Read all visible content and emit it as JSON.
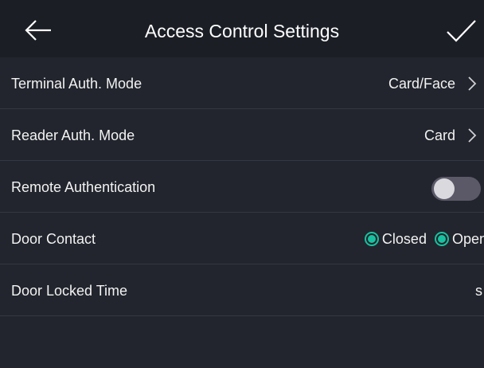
{
  "header": {
    "title": "Access Control Settings"
  },
  "settings": {
    "terminal_auth": {
      "label": "Terminal Auth. Mode",
      "value": "Card/Face"
    },
    "reader_auth": {
      "label": "Reader Auth. Mode",
      "value": "Card"
    },
    "remote_auth": {
      "label": "Remote Authentication",
      "enabled": false
    },
    "door_contact": {
      "label": "Door Contact",
      "options": [
        "Closed",
        "Open"
      ]
    },
    "door_locked_time": {
      "label": "Door Locked Time",
      "unit": "s"
    }
  },
  "colors": {
    "accent": "#18c2a0",
    "background": "#1b1e25",
    "list_background": "#22252d",
    "toggle_off": "#5b5968"
  },
  "icons": {
    "back": "arrow-left-icon",
    "confirm": "checkmark-icon",
    "chevron": "chevron-right-icon"
  }
}
